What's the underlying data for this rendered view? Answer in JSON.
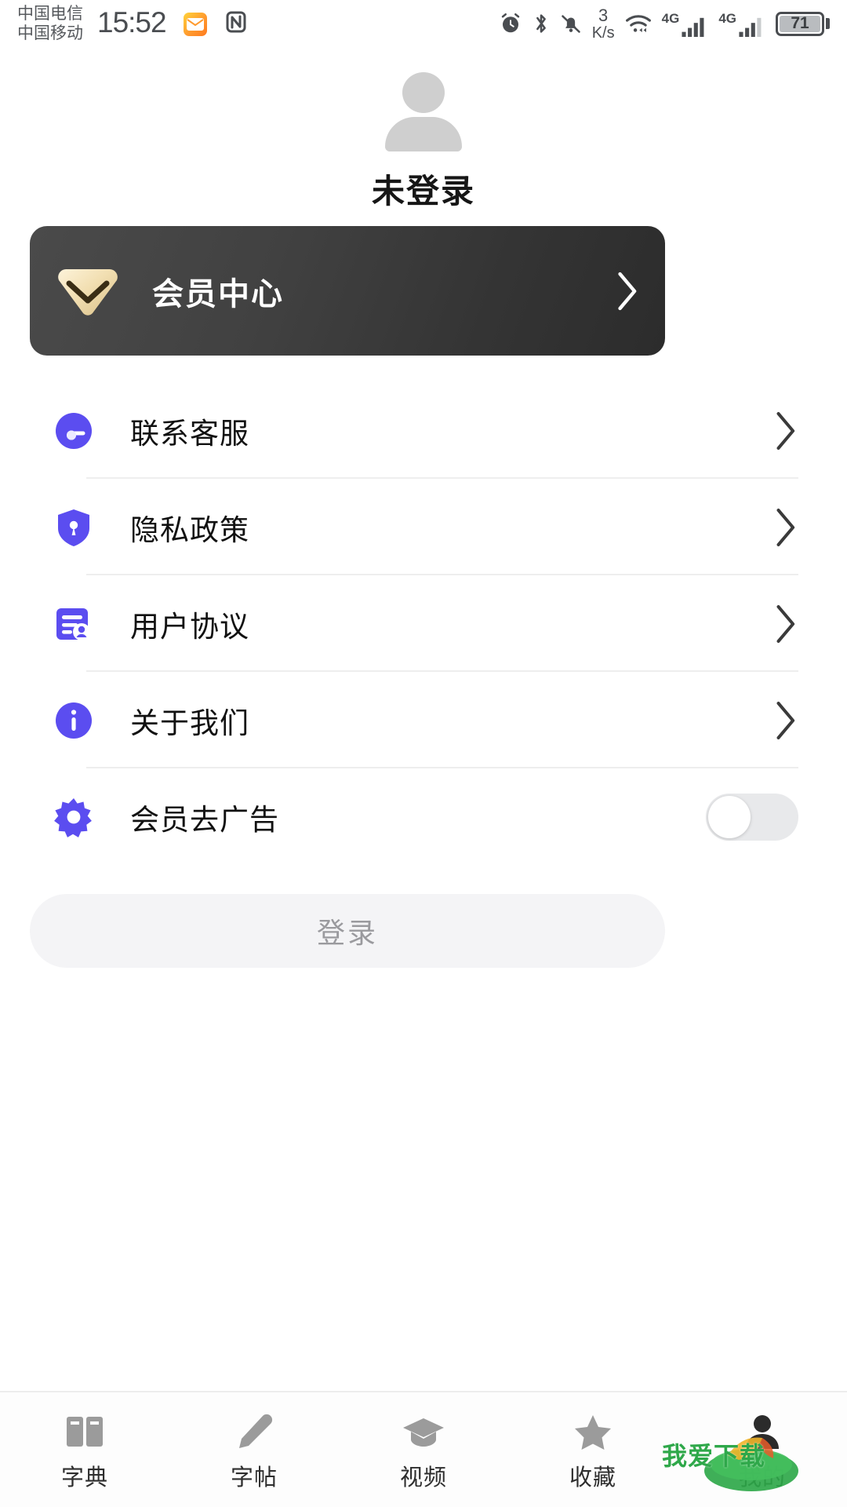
{
  "status_bar": {
    "carrier_primary": "中国电信",
    "carrier_secondary": "中国移动",
    "time": "15:52",
    "mail_icon": "mail-icon",
    "nfc_icon": "nfc-icon",
    "alarm_icon": "alarm-icon",
    "bluetooth_icon": "bluetooth-icon",
    "mute_icon": "bell-muted-icon",
    "net_speed_value": "3",
    "net_speed_unit": "K/s",
    "wifi_icon": "wifi-icon",
    "signal_1_label": "4G",
    "signal_2_label": "4G",
    "battery_percent": "71"
  },
  "profile": {
    "avatar_icon": "person-avatar-icon",
    "username": "未登录"
  },
  "vip_card": {
    "icon": "diamond-gem-icon",
    "label": "会员中心",
    "chevron_icon": "chevron-right-icon",
    "bg_start": "#4a4a4a",
    "bg_end": "#2c2c2c",
    "gem_color": "#f0ddb4"
  },
  "menu": {
    "accent_color": "#5b4df0",
    "items": [
      {
        "icon": "headset-support-icon",
        "label": "联系客服",
        "tail": "chevron"
      },
      {
        "icon": "shield-lock-icon",
        "label": "隐私政策",
        "tail": "chevron"
      },
      {
        "icon": "document-signed-icon",
        "label": "用户协议",
        "tail": "chevron"
      },
      {
        "icon": "info-circle-icon",
        "label": "关于我们",
        "tail": "chevron"
      },
      {
        "icon": "gear-settings-icon",
        "label": "会员去广告",
        "tail": "toggle",
        "toggle_on": false
      }
    ]
  },
  "login_button": {
    "label": "登录",
    "enabled": false
  },
  "bottom_nav": {
    "items": [
      {
        "icon": "book-icon",
        "label": "字典",
        "active": false
      },
      {
        "icon": "pen-icon",
        "label": "字帖",
        "active": false
      },
      {
        "icon": "graduation-cap-icon",
        "label": "视频",
        "active": false
      },
      {
        "icon": "star-icon",
        "label": "收藏",
        "active": false
      },
      {
        "icon": "person-icon",
        "label": "我的",
        "active": true
      }
    ]
  },
  "watermark": {
    "text": "我爱下载",
    "color": "#2fa84a"
  }
}
